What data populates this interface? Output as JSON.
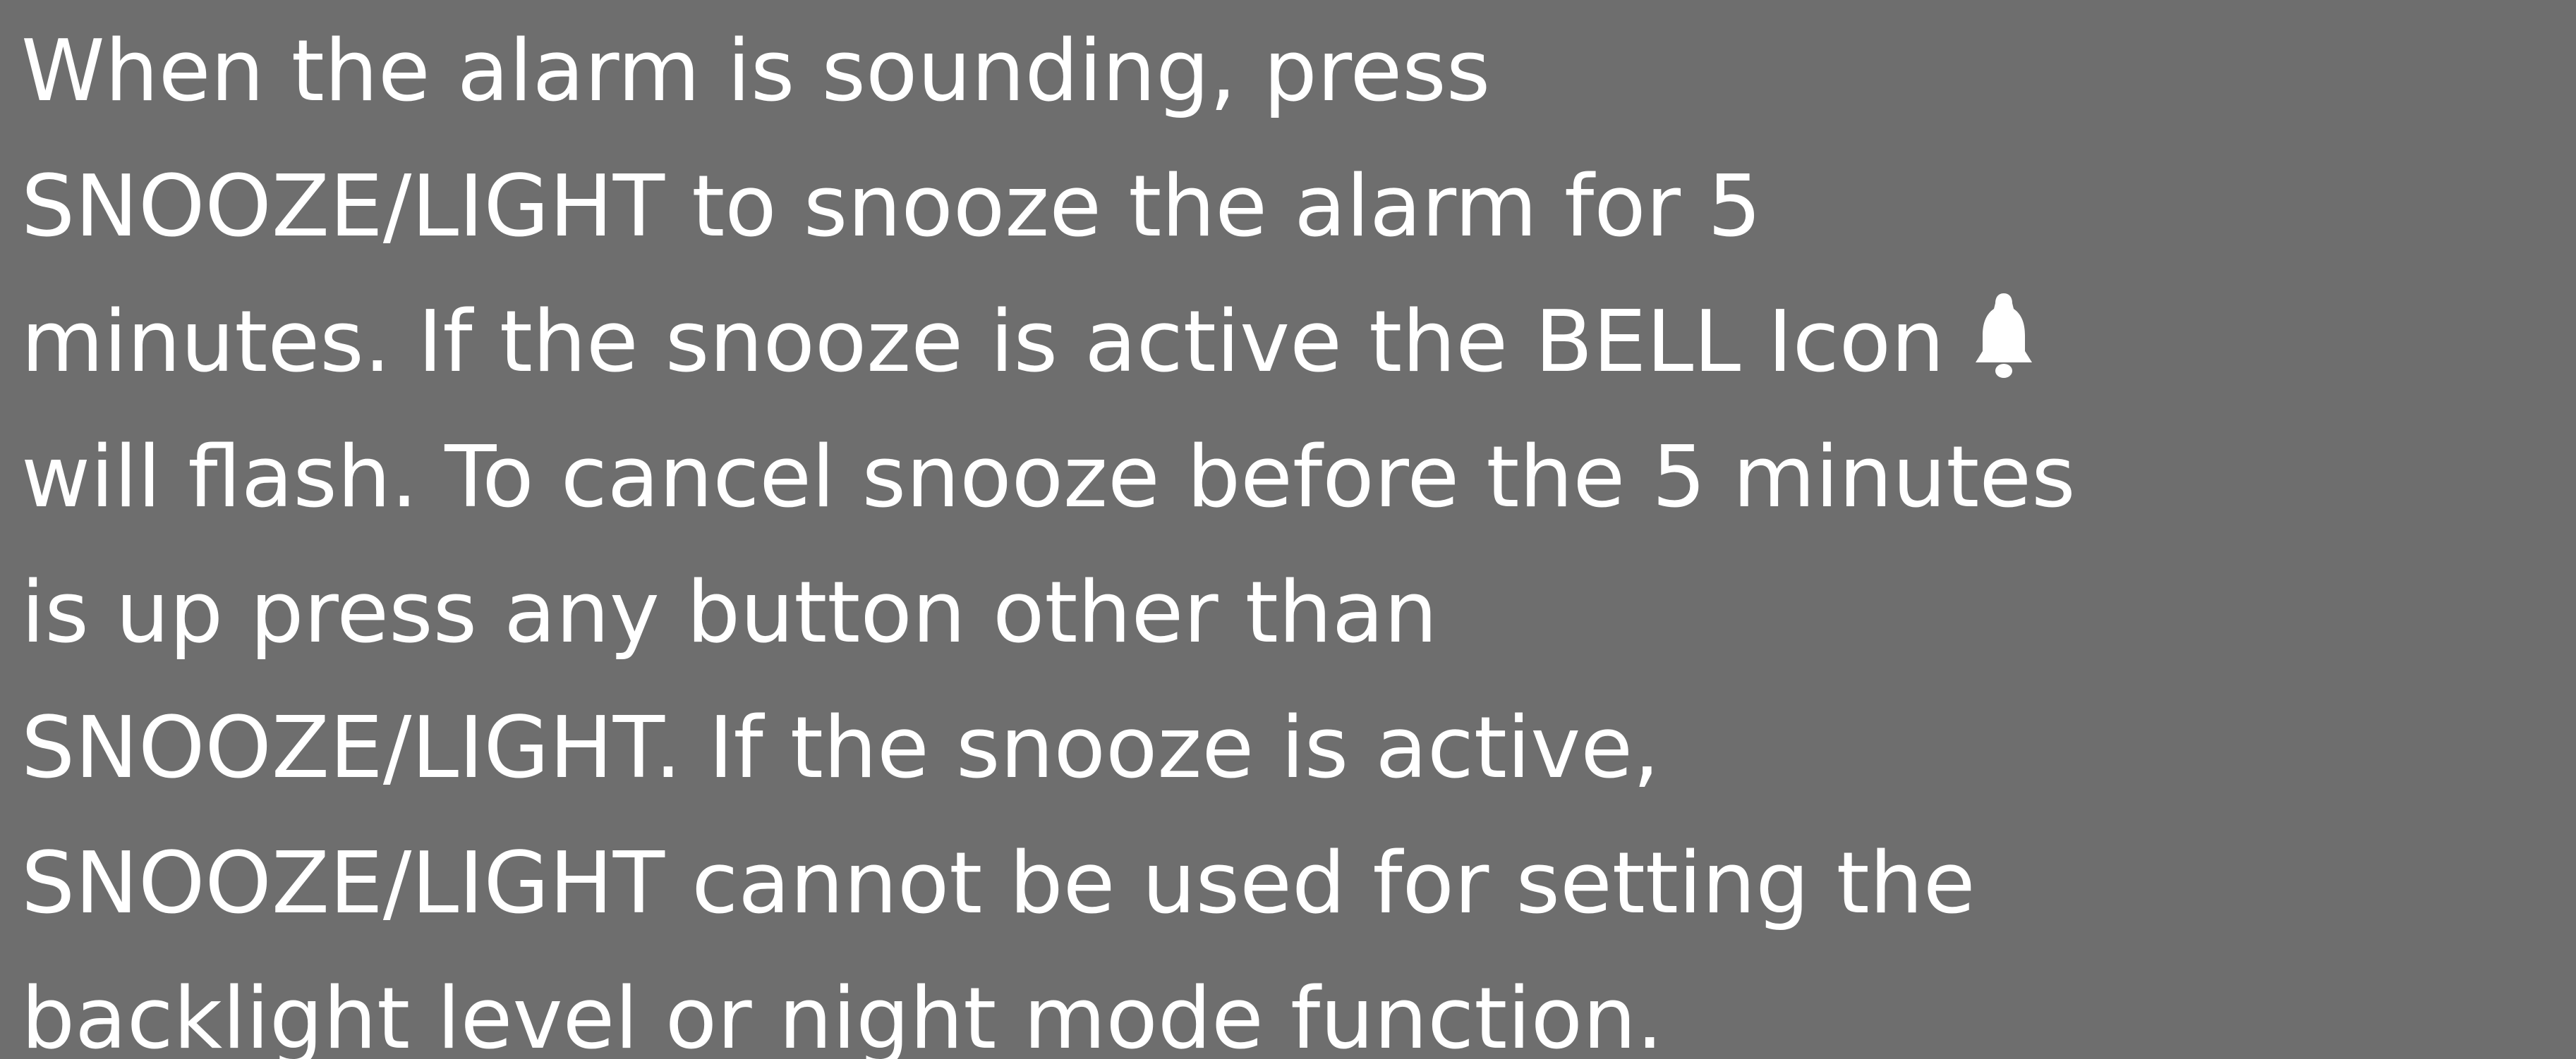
{
  "instruction": {
    "lines": [
      "When the alarm is sounding, press",
      "SNOOZE/LIGHT to snooze the alarm for 5",
      "minutes. If the snooze is active the BELL Icon",
      "will flash. To cancel snooze before the 5 minutes",
      "is up press any button other than",
      "SNOOZE/LIGHT. If the snooze is active,",
      "SNOOZE/LIGHT cannot be used for setting the",
      "backlight level or night mode function."
    ],
    "inline_icon": "bell-icon"
  },
  "colors": {
    "background": "#6e6e6e",
    "text": "#ffffff"
  }
}
